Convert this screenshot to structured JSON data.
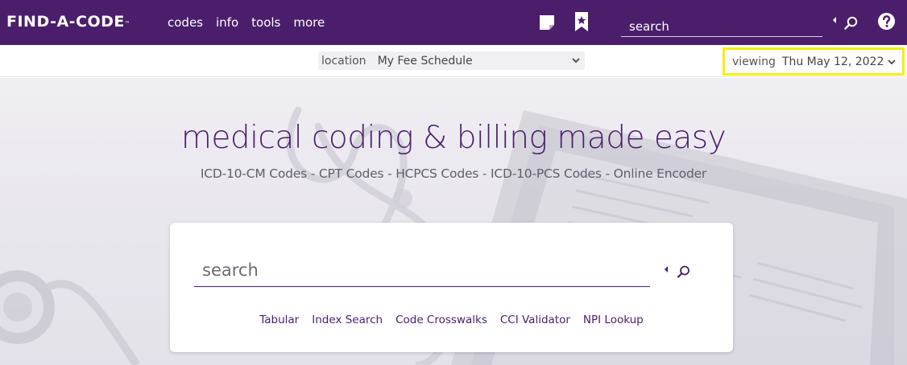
{
  "header": {
    "logo_text": "FIND-A-CODE",
    "logo_tm": "™",
    "nav": [
      "codes",
      "info",
      "tools",
      "more"
    ],
    "search_placeholder": "search",
    "icons": {
      "note": "sticky-note-icon",
      "bookmark": "bookmark-star-icon",
      "search": "magnifier-icon",
      "help": "question-circle-icon"
    }
  },
  "subbar": {
    "location_label": "location",
    "location_value": "My Fee Schedule",
    "viewing_label": "viewing",
    "viewing_value": "Thu May 12, 2022"
  },
  "hero": {
    "headline": "medical coding & billing made easy",
    "subhead": "ICD-10-CM Codes - CPT Codes - HCPCS Codes - ICD-10-PCS Codes - Online Encoder",
    "search_placeholder": "search",
    "links": [
      "Tabular",
      "Index Search",
      "Code Crosswalks",
      "CCI Validator",
      "NPI Lookup"
    ]
  },
  "colors": {
    "brand_purple": "#4b1e6b",
    "highlight_yellow": "#f7ee08",
    "white": "#ffffff"
  }
}
